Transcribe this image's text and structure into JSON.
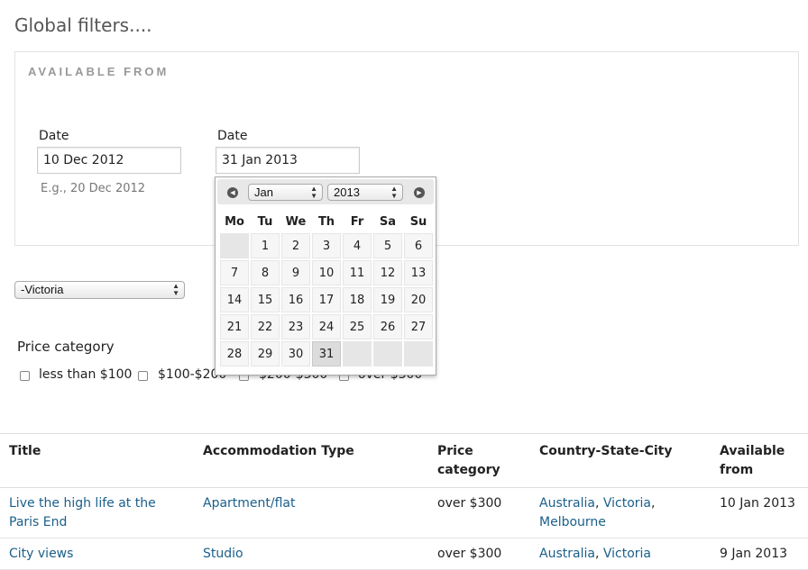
{
  "page": {
    "title": "Global filters...."
  },
  "filters": {
    "legend": "AVAILABLE FROM",
    "date_from": {
      "label": "Date",
      "value": "10 Dec 2012",
      "description": "E.g., 20 Dec 2012"
    },
    "date_to": {
      "label": "Date",
      "value": "31 Jan 2013"
    },
    "region_select": {
      "value": "-Victoria"
    },
    "price": {
      "label": "Price category",
      "options": [
        "less than $100",
        "$100-$200",
        "$200-$300",
        "over $300"
      ]
    }
  },
  "datepicker": {
    "month": "Jan",
    "year": "2013",
    "weekdays": [
      "Mo",
      "Tu",
      "We",
      "Th",
      "Fr",
      "Sa",
      "Su"
    ],
    "days": [
      "1",
      "2",
      "3",
      "4",
      "5",
      "6",
      "7",
      "8",
      "9",
      "10",
      "11",
      "12",
      "13",
      "14",
      "15",
      "16",
      "17",
      "18",
      "19",
      "20",
      "21",
      "22",
      "23",
      "24",
      "25",
      "26",
      "27",
      "28",
      "29",
      "30",
      "31"
    ],
    "selected": "31"
  },
  "table": {
    "columns": [
      "Title",
      "Accommodation Type",
      "Price category",
      "Country-State-City",
      "Available from"
    ],
    "rows": [
      {
        "title": "Live the high life at the Paris End",
        "type": "Apartment/flat",
        "price": "over $300",
        "location": [
          "Australia",
          "Victoria",
          "Melbourne"
        ],
        "available": "10 Jan 2013"
      },
      {
        "title": "City views",
        "type": "Studio",
        "price": "over $300",
        "location": [
          "Australia",
          "Victoria"
        ],
        "available": "9 Jan 2013"
      }
    ]
  }
}
